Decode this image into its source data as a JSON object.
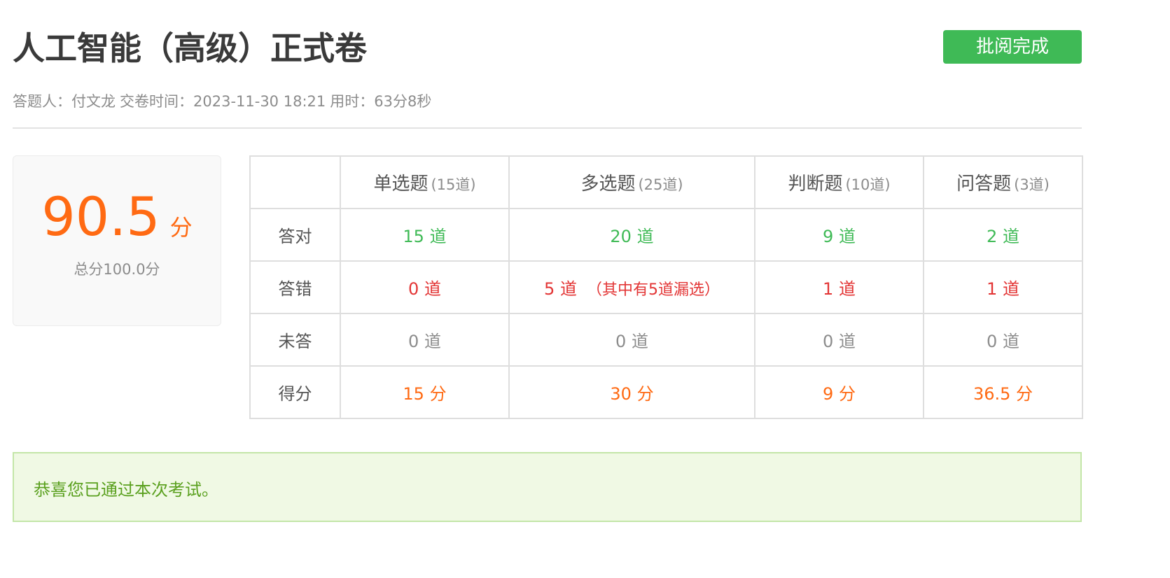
{
  "header": {
    "title": "人工智能（高级）正式卷",
    "finish_button": "批阅完成"
  },
  "meta": {
    "examinee": "答题人：付文龙",
    "submit_time": "交卷时间：2023-11-30 18:21",
    "duration": "用时：63分8秒"
  },
  "score": {
    "value": "90.5",
    "unit": "分",
    "total": "总分100.0分"
  },
  "table": {
    "columns": [
      {
        "name": "单选题",
        "count": "(15道)"
      },
      {
        "name": "多选题",
        "count": "(25道)"
      },
      {
        "name": "判断题",
        "count": "(10道)"
      },
      {
        "name": "问答题",
        "count": "(3道)"
      }
    ],
    "rows": {
      "correct": {
        "label": "答对",
        "cells": [
          "15 道",
          "20 道",
          "9 道",
          "2 道"
        ]
      },
      "wrong": {
        "label": "答错",
        "cells": [
          "0 道",
          "5 道",
          "1 道",
          "1 道"
        ],
        "note": "（其中有5道漏选）"
      },
      "unanswered": {
        "label": "未答",
        "cells": [
          "0 道",
          "0 道",
          "0 道",
          "0 道"
        ]
      },
      "points": {
        "label": "得分",
        "cells": [
          "15 分",
          "30 分",
          "9 分",
          "36.5 分"
        ]
      }
    }
  },
  "result_message": "恭喜您已通过本次考试。",
  "colors": {
    "accent_green": "#3fba56",
    "score_orange": "#ff6a13",
    "error_red": "#e33535",
    "pass_bg": "#f0f9e4"
  }
}
